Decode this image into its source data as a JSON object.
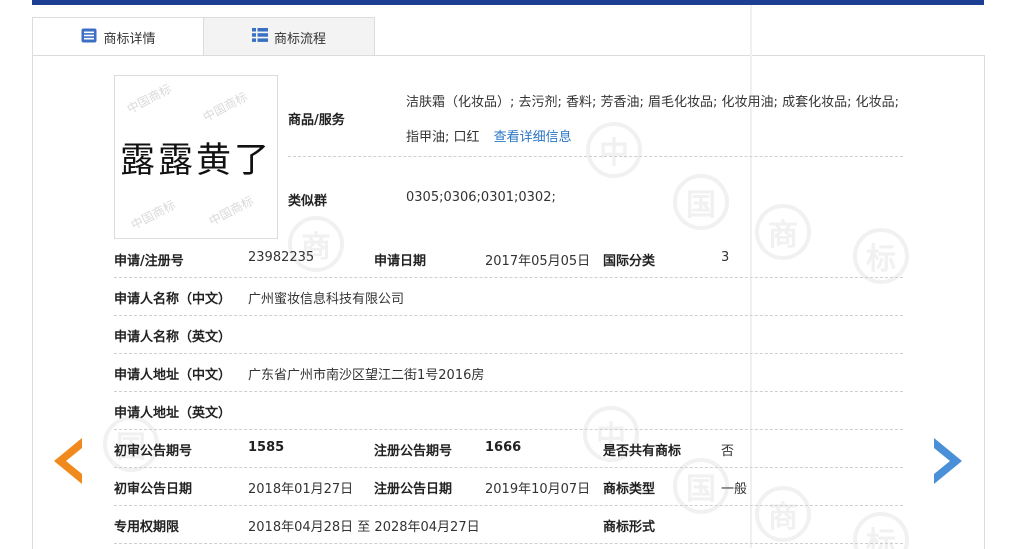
{
  "tabs": [
    {
      "label": "商标详情",
      "icon": "document-list-icon"
    },
    {
      "label": "商标流程",
      "icon": "grid-list-icon"
    }
  ],
  "logo": {
    "text": "露露黄了",
    "watermark": "中国商标"
  },
  "goods": {
    "label": "商品/服务",
    "line1": "洁肤霜（化妆品）; 去污剂; 香料; 芳香油; 眉毛化妆品; 化妆用油; 成套化妆品; 化妆品;",
    "line2": "指甲油; 口红",
    "link": "查看详细信息"
  },
  "similar": {
    "label": "类似群",
    "value": "0305;0306;0301;0302;"
  },
  "rows": {
    "reg_no": {
      "label": "申请/注册号",
      "value": "23982235"
    },
    "apply_date": {
      "label": "申请日期",
      "value": "2017年05月05日"
    },
    "intl_class": {
      "label": "国际分类",
      "value": "3"
    },
    "applicant_cn": {
      "label": "申请人名称（中文）",
      "value": "广州蜜妆信息科技有限公司"
    },
    "applicant_en": {
      "label": "申请人名称（英文）",
      "value": ""
    },
    "address_cn": {
      "label": "申请人地址（中文）",
      "value": "广东省广州市南沙区望江二街1号2016房"
    },
    "address_en": {
      "label": "申请人地址（英文）",
      "value": ""
    },
    "prelim_no": {
      "label": "初审公告期号",
      "value": "1585"
    },
    "reg_pub_no": {
      "label": "注册公告期号",
      "value": "1666"
    },
    "shared": {
      "label": "是否共有商标",
      "value": "否"
    },
    "prelim_date": {
      "label": "初审公告日期",
      "value": "2018年01月27日"
    },
    "reg_pub_date": {
      "label": "注册公告日期",
      "value": "2019年10月07日"
    },
    "tm_type": {
      "label": "商标类型",
      "value": "一般"
    },
    "exclusive": {
      "label": "专用权期限",
      "value": "2018年04月28日 至 2028年04月27日"
    },
    "tm_form": {
      "label": "商标形式",
      "value": ""
    }
  },
  "watermark": {
    "chars": [
      "中",
      "国",
      "商",
      "标"
    ]
  },
  "colors": {
    "topbar": "#1c3f94",
    "prev_arrow": "#f08a1c",
    "next_arrow": "#4a90d9",
    "link": "#2a76c6"
  }
}
